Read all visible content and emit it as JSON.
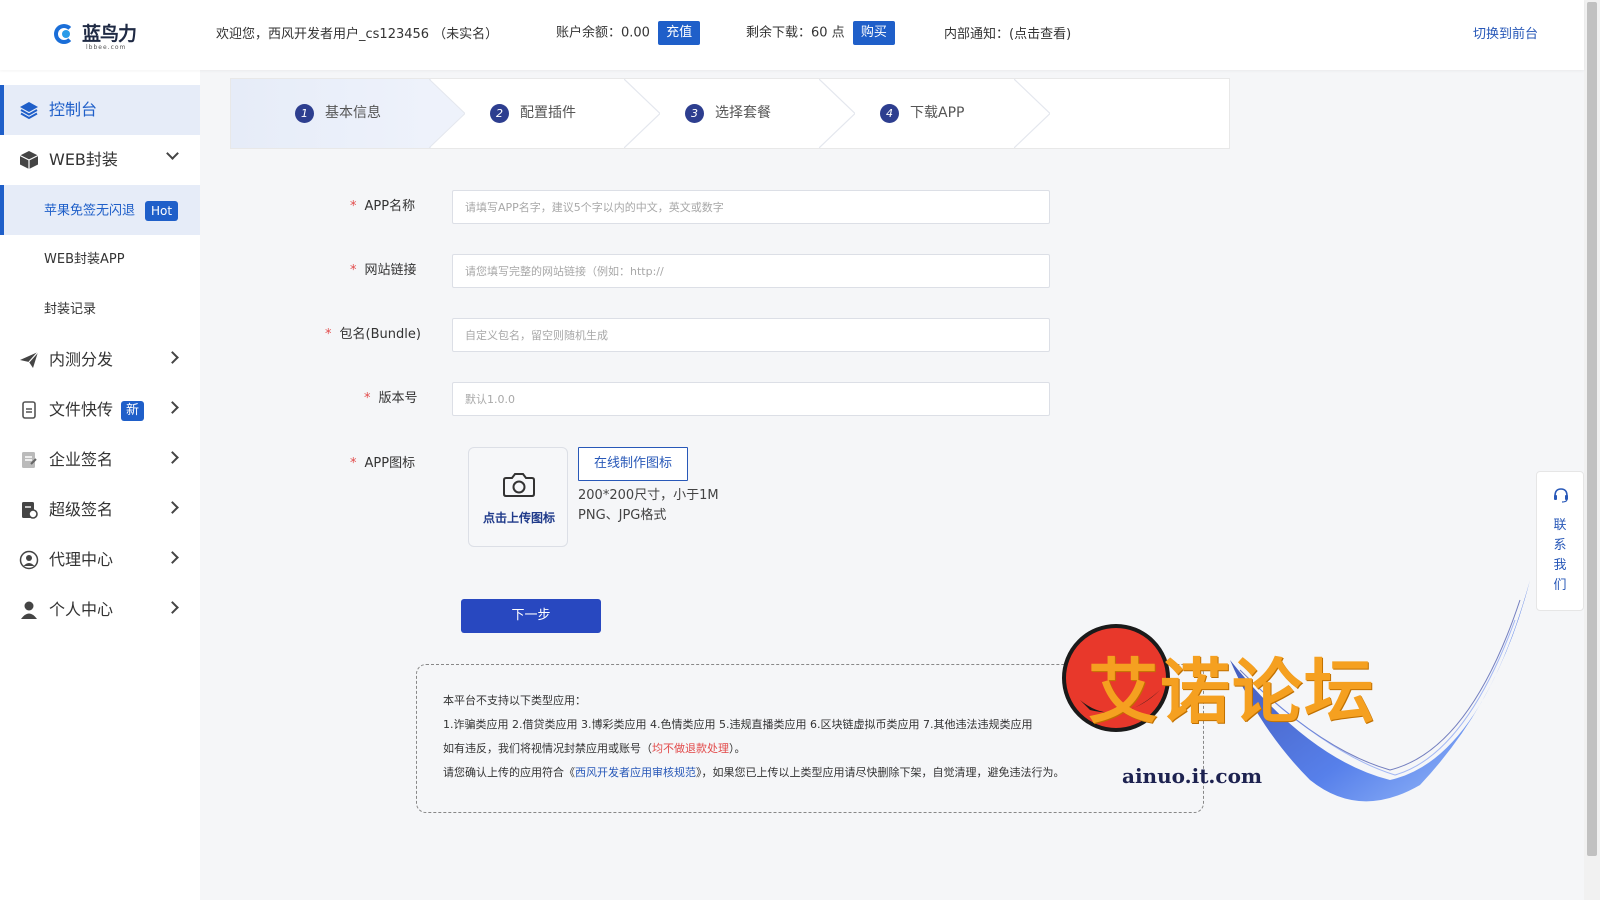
{
  "header": {
    "logo_text": "蓝鸟力",
    "logo_sub": "lbbee.com",
    "welcome": "欢迎您，西风开发者用户_cs123456 （未实名）",
    "balance_label": "账户余额：0.00",
    "recharge_label": "充值",
    "downloads_label": "剩余下载：60 点",
    "buy_label": "购买",
    "notice_label": "内部通知：(点击查看)",
    "switch_label": "切换到前台"
  },
  "sidebar": {
    "items": [
      {
        "label": "控制台",
        "icon": "layers-icon"
      },
      {
        "label": "WEB封装",
        "icon": "box-icon"
      },
      {
        "label": "内测分发",
        "icon": "paper-plane-icon"
      },
      {
        "label": "文件快传",
        "icon": "file-transfer-icon",
        "badge": "新"
      },
      {
        "label": "企业签名",
        "icon": "enterprise-sign-icon"
      },
      {
        "label": "超级签名",
        "icon": "super-sign-icon"
      },
      {
        "label": "代理中心",
        "icon": "agent-icon"
      },
      {
        "label": "个人中心",
        "icon": "user-icon"
      }
    ],
    "sub_items": [
      {
        "label": "苹果免签无闪退",
        "badge": "Hot"
      },
      {
        "label": "WEB封装APP"
      },
      {
        "label": "封装记录"
      }
    ]
  },
  "steps": [
    {
      "num": "1",
      "label": "基本信息"
    },
    {
      "num": "2",
      "label": "配置插件"
    },
    {
      "num": "3",
      "label": "选择套餐"
    },
    {
      "num": "4",
      "label": "下载APP"
    }
  ],
  "form": {
    "app_name_label": "APP名称",
    "app_name_placeholder": "请填写APP名字，建议5个字以内的中文，英文或数字",
    "url_label": "网站链接",
    "url_placeholder": "请您填写完整的网站链接（例如：http://",
    "bundle_label": "包名(Bundle)",
    "bundle_placeholder": "自定义包名，留空则随机生成",
    "version_label": "版本号",
    "version_placeholder": "默认1.0.0",
    "icon_label": "APP图标",
    "upload_text": "点击上传图标",
    "make_icon_label": "在线制作图标",
    "hint_size": "200*200尺寸，小于1M",
    "hint_format": "PNG、JPG格式",
    "next_label": "下一步"
  },
  "notice": {
    "line1": "本平台不支持以下类型应用：",
    "line2": "1.诈骗类应用 2.借贷类应用 3.博彩类应用 4.色情类应用 5.违规直播类应用 6.区块链虚拟币类应用 7.其他违法违规类应用",
    "line3_a": "如有违反，我们将视情况封禁应用或账号（",
    "line3_red": "均不做退款处理",
    "line3_b": "）。",
    "line4_a": "请您确认上传的应用符合《",
    "line4_link": "西风开发者应用审核规范",
    "line4_b": "》，如果您已上传以上类型应用请尽快删除下架，自觉清理，避免违法行为。"
  },
  "contact": {
    "text": "联系我们",
    "icon": "headset-icon"
  },
  "watermark": {
    "text": "艾诺论坛",
    "url": "ainuo.it.com"
  },
  "colors": {
    "primary": "#1f5fc9",
    "button": "#2848c0",
    "danger": "#e24a4a",
    "accent": "#f5a020"
  }
}
